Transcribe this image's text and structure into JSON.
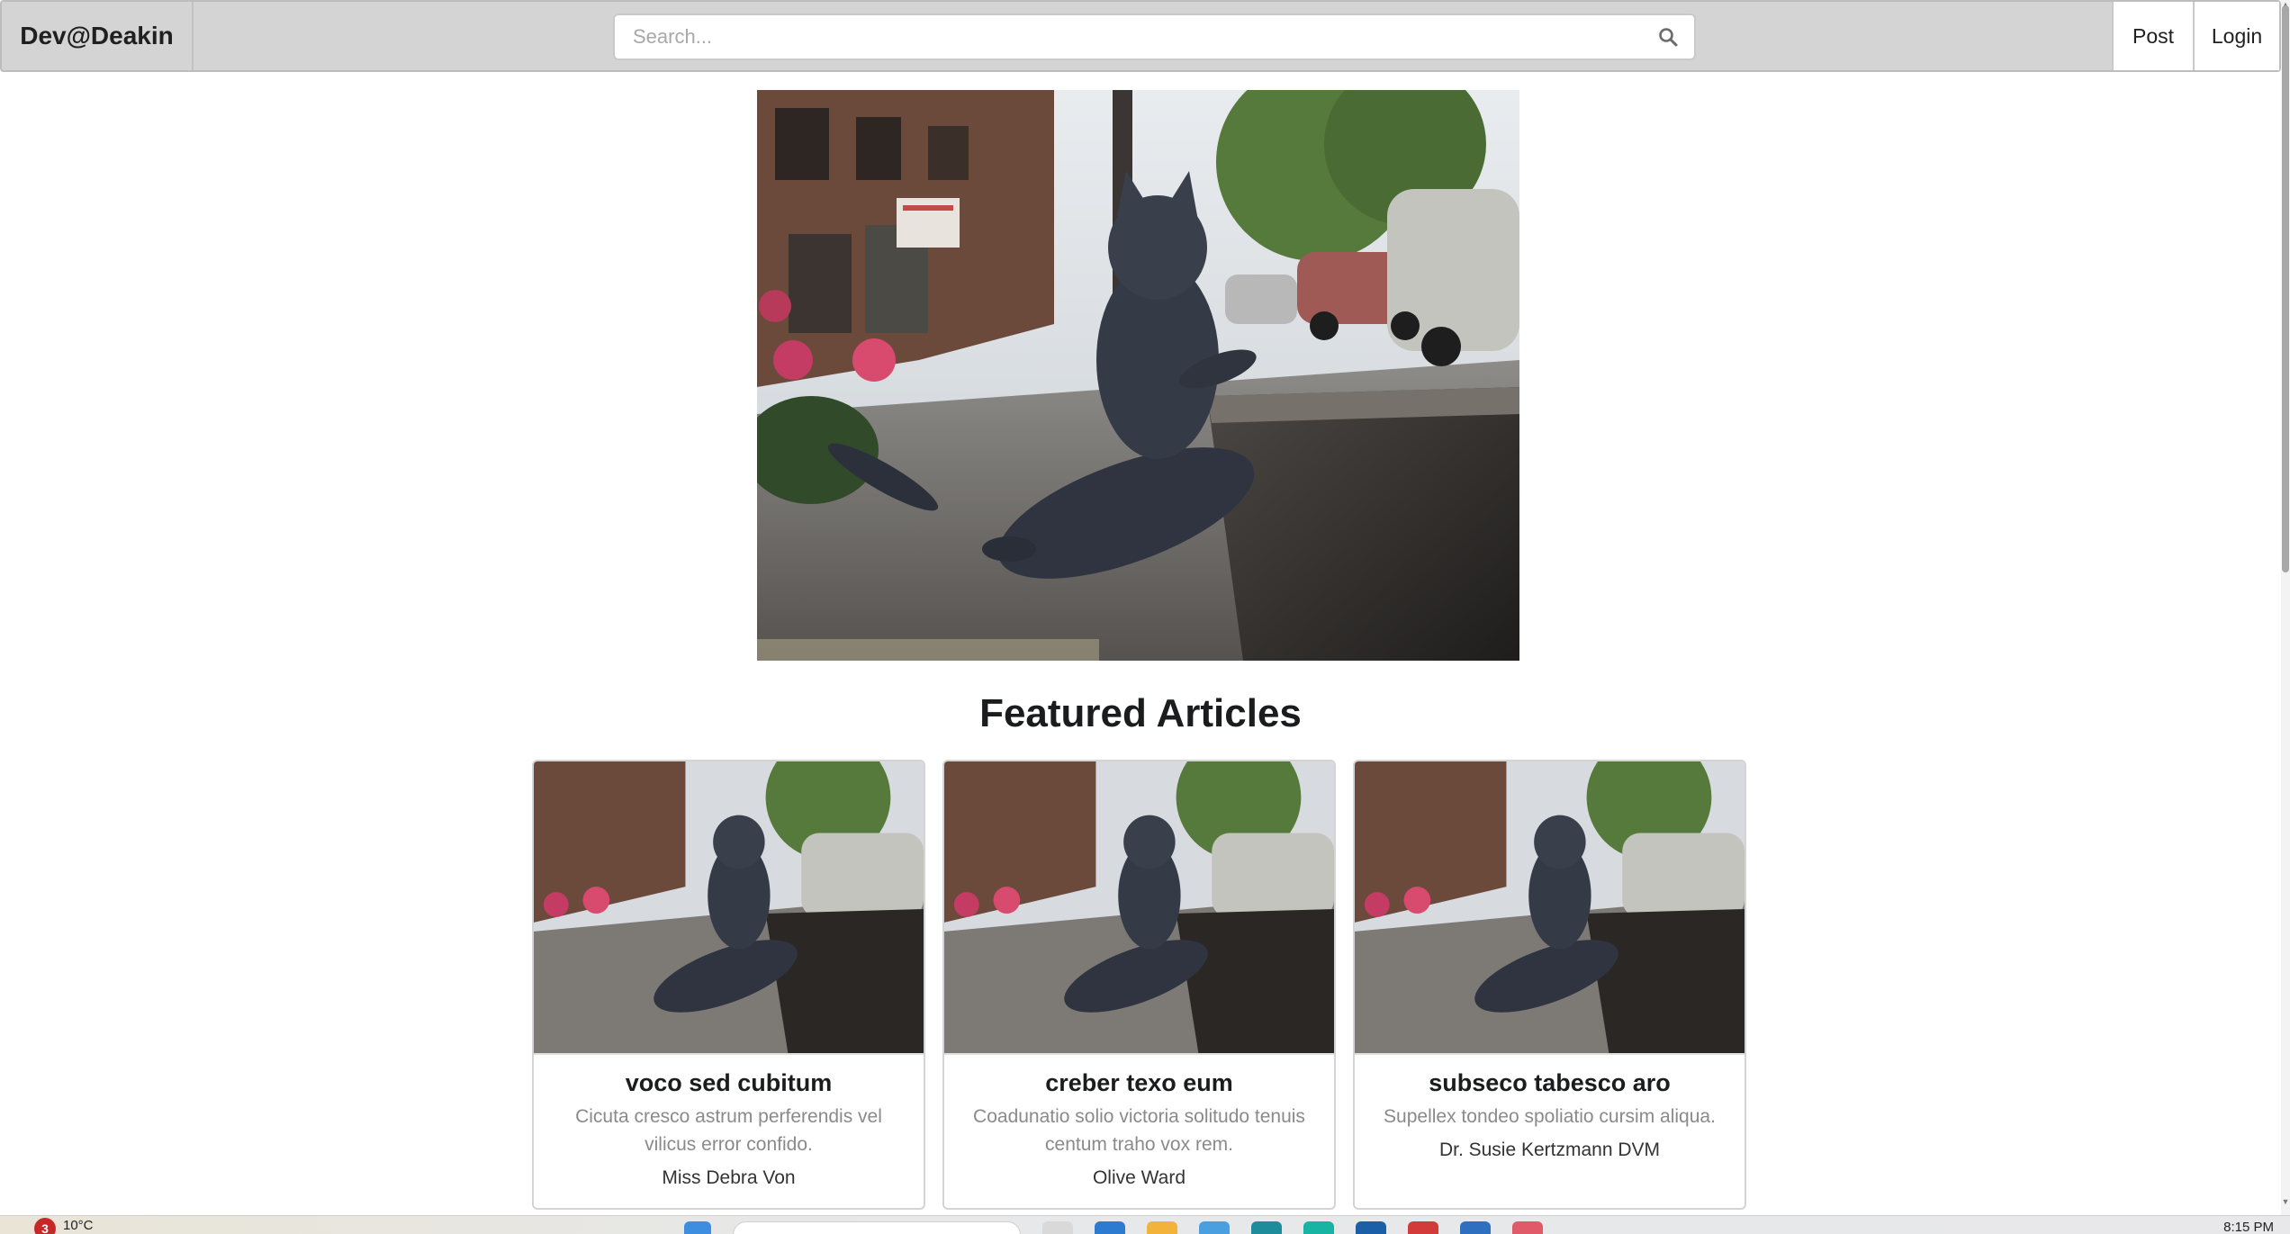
{
  "navbar": {
    "brand": "Dev@Deakin",
    "search_placeholder": "Search...",
    "post_label": "Post",
    "login_label": "Login"
  },
  "main": {
    "section_title": "Featured Articles",
    "cards": [
      {
        "title": "voco sed cubitum",
        "description": "Cicuta cresco astrum perferendis vel vilicus error confido.",
        "author": "Miss Debra Von"
      },
      {
        "title": "creber texo eum",
        "description": "Coadunatio solio victoria solitudo tenuis centum traho vox rem.",
        "author": "Olive Ward"
      },
      {
        "title": "subseco tabesco aro",
        "description": "Supellex tondeo spoliatio cursim aliqua.",
        "author": "Dr. Susie Kertzmann DVM"
      }
    ]
  },
  "taskbar": {
    "weather": "10°C",
    "notification_count": "3",
    "clock": "8:15 PM"
  },
  "colors": {
    "menubar_bg": "#d4d4d4",
    "card_border": "#d4d4d5",
    "description_grey": "#8a8a8a",
    "notification_red": "#c62828"
  },
  "icons": [
    "search-icon",
    "cat-statue-photo",
    "windows-start-icon"
  ]
}
